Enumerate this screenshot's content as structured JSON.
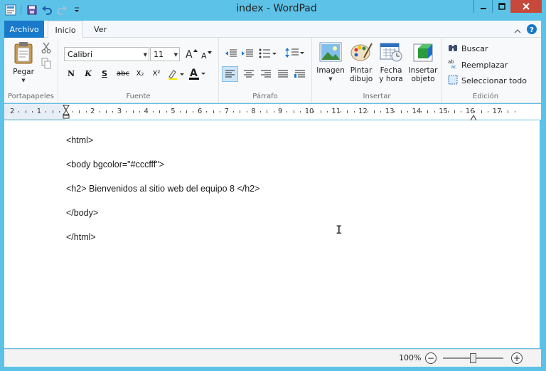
{
  "title": "index - WordPad",
  "tabs": {
    "file": "Archivo",
    "home": "Inicio",
    "view": "Ver"
  },
  "ribbon": {
    "clipboard": {
      "paste": "Pegar",
      "label": "Portapapeles"
    },
    "font": {
      "family": "Calibri",
      "size": "11",
      "label": "Fuente",
      "bold": "N",
      "italic": "K",
      "underline": "S",
      "strike": "abc",
      "subscript": "X₂",
      "superscript": "X²"
    },
    "paragraph": {
      "label": "Párrafo"
    },
    "insert": {
      "label": "Insertar",
      "image": "Imagen",
      "paint_line1": "Pintar",
      "paint_line2": "dibujo",
      "datetime_line1": "Fecha",
      "datetime_line2": "y hora",
      "object_line1": "Insertar",
      "object_line2": "objeto"
    },
    "editing": {
      "label": "Edición",
      "find": "Buscar",
      "replace": "Reemplazar",
      "select_all": "Seleccionar todo"
    }
  },
  "ruler": {
    "numbers": [
      "2",
      "1",
      "1",
      "2",
      "3",
      "4",
      "5",
      "6",
      "7",
      "8",
      "9",
      "10",
      "11",
      "12",
      "13",
      "14",
      "15",
      "16",
      "17"
    ]
  },
  "document": {
    "lines": [
      "<html>",
      "<body bgcolor=\"#cccfff\">",
      "<h2> Bienvenidos al sitio web del equipo 8 </h2>",
      "</body>",
      "</html>"
    ]
  },
  "status": {
    "zoom": "100%",
    "zoom_fraction": 0.5
  },
  "colors": {
    "accent": "#1979ca",
    "titlebar": "#5cc2e7",
    "close": "#c7493b"
  }
}
